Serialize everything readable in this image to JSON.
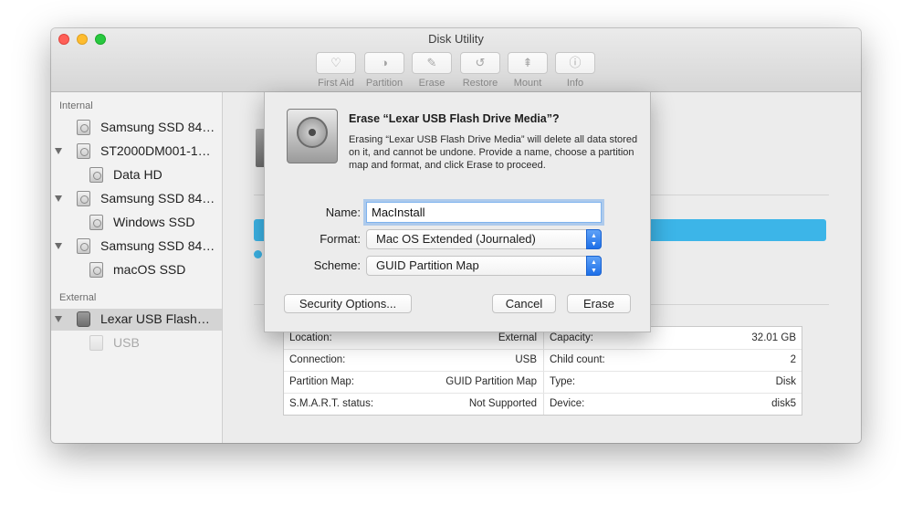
{
  "window": {
    "title": "Disk Utility"
  },
  "toolbar": {
    "buttons": [
      {
        "label": "First Aid",
        "icon": "stethoscope-icon",
        "glyph": "♡"
      },
      {
        "label": "Partition",
        "icon": "partition-pie-icon",
        "glyph": "◑"
      },
      {
        "label": "Erase",
        "icon": "eraser-icon",
        "glyph": "✎"
      },
      {
        "label": "Restore",
        "icon": "restore-icon",
        "glyph": "↺"
      },
      {
        "label": "Mount",
        "icon": "mount-icon",
        "glyph": "⇞"
      },
      {
        "label": "Info",
        "icon": "info-icon",
        "glyph": "ⓘ"
      }
    ]
  },
  "sidebar": {
    "sections": [
      {
        "header": "Internal",
        "items": [
          {
            "label": "Samsung SSD 84…"
          },
          {
            "label": "ST2000DM001-1…"
          },
          {
            "label": "Data HD"
          },
          {
            "label": "Samsung SSD 84…"
          },
          {
            "label": "Windows SSD"
          },
          {
            "label": "Samsung SSD 84…"
          },
          {
            "label": "macOS SSD"
          }
        ]
      },
      {
        "header": "External",
        "items": [
          {
            "label": "Lexar USB Flash…"
          },
          {
            "label": "USB"
          }
        ]
      }
    ]
  },
  "dialog": {
    "title": "Erase “Lexar USB Flash Drive Media”?",
    "message": "Erasing “Lexar USB Flash Drive Media” will delete all data stored on it, and cannot be undone. Provide a name, choose a partition map and format, and click Erase to proceed.",
    "name_label": "Name:",
    "name_value": "MacInstall",
    "format_label": "Format:",
    "format_value": "Mac OS Extended (Journaled)",
    "scheme_label": "Scheme:",
    "scheme_value": "GUID Partition Map",
    "security_button": "Security Options...",
    "cancel_button": "Cancel",
    "erase_button": "Erase"
  },
  "info": {
    "rows": [
      {
        "left_key": "Location:",
        "left_value": "External",
        "right_key": "Capacity:",
        "right_value": "32.01 GB"
      },
      {
        "left_key": "Connection:",
        "left_value": "USB",
        "right_key": "Child count:",
        "right_value": "2"
      },
      {
        "left_key": "Partition Map:",
        "left_value": "GUID Partition Map",
        "right_key": "Type:",
        "right_value": "Disk"
      },
      {
        "left_key": "S.M.A.R.T. status:",
        "left_value": "Not Supported",
        "right_key": "Device:",
        "right_value": "disk5"
      }
    ]
  },
  "colors": {
    "accent": "#3cb5e8",
    "selection": "#d4d4d4",
    "focus_ring": "#7fb3ee"
  }
}
